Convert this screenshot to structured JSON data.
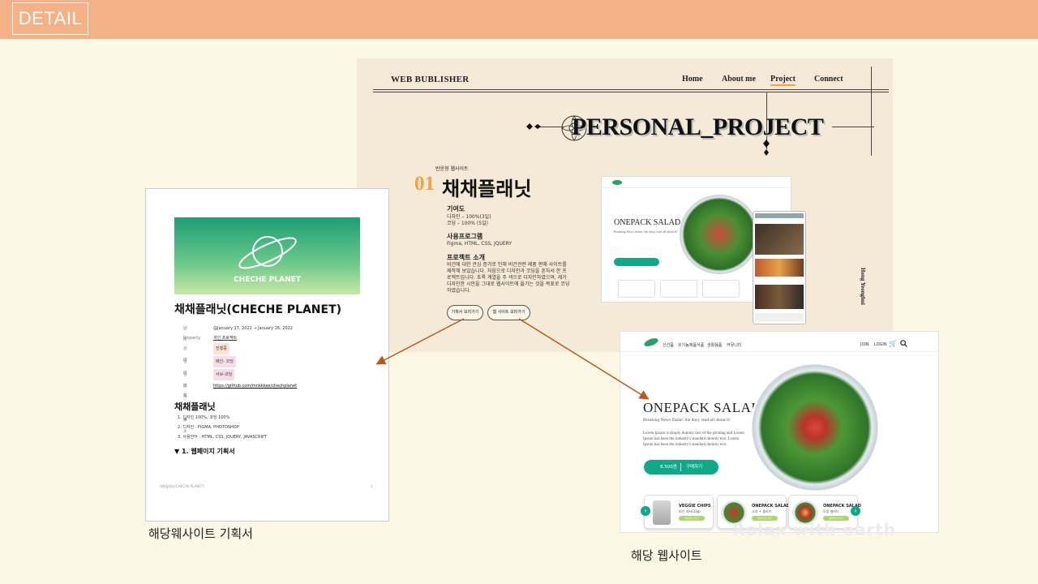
{
  "header": {
    "tag": "DETAIL"
  },
  "hero": {
    "logo": "WEB BUBLISHER",
    "nav": [
      "Home",
      "About me",
      "Project",
      "Connect"
    ],
    "active_nav": "Project",
    "title": "PERSONAL_PROJECT",
    "vertical_name": "Hong Yeonghui",
    "project": {
      "small_label": "반응형 웹사이트",
      "number": "01",
      "name": "채채플래닛",
      "contribution_title": "기여도",
      "contribution_lines": [
        "디자인 – 100%(3일)",
        "코딩 – 100% (5일)"
      ],
      "programs_title": "사용프로그램",
      "programs": "Figma, HTML, CSS, JQUERY",
      "intro_title": "프로젝트 소개",
      "intro_lines": [
        "비건에 대한 관심 증가로 인해 비건관련 제품 판매 사이트를",
        "제작해 보았습니다. 처음으로 디자인과 코딩을 혼자서 한 프",
        "로젝트입니다. 초록 계열을 주 색으로 디자인하였으며, 제가",
        "디자인한 시안을 그대로 웹사이트에 옮기는 것을 목표로 코딩",
        "하였습니다."
      ],
      "button_plan": "기획서 보러가기",
      "button_site": "웹 사이트 보러가기"
    },
    "mockup": {
      "title": "ONEPACK SALAD",
      "subtitle": "Breaking News flashe: the dayy read all about it!"
    }
  },
  "document": {
    "cover_text": "CHECHE PLANET",
    "title": "채채플래닛(CHECHE PLANET)",
    "properties": [
      {
        "key": "날짜",
        "value": "@January 17, 2022 → January 26, 2022",
        "tag_color": ""
      },
      {
        "key": "Property",
        "value": "개인 프로젝트",
        "tag_color": ""
      },
      {
        "key": "상태",
        "value": "진행중",
        "tag_color": "#fde2d6"
      },
      {
        "key": "상태_확인",
        "value": "메인- 코딩",
        "tag_color": "#f7dde8"
      },
      {
        "key": "상태_서브",
        "value": "서브-코딩",
        "tag_color": "#f7dde8"
      },
      {
        "key": "깃 허브 주소",
        "value": "https://github.com/mnkkkee/chechplanet",
        "tag_color": ""
      }
    ],
    "heading": "채채플래닛",
    "list": [
      "디자인 100%, 코딩 100%",
      "디자인 : FIGMA, PHOTOSHOP",
      "사용언어 : HTML, CSS, JQUERY, JAVASCRIPT"
    ],
    "toggle": "▼ 1. 웹페이지 기획서",
    "footer_left": "채채플래닛(CHECHE PLANET)",
    "footer_right": "1"
  },
  "site": {
    "nav": [
      "신선품",
      "유기농제품",
      "식품",
      "생활용품",
      "커뮤니티"
    ],
    "auth": [
      "JOIN",
      "LOGIN"
    ],
    "title": "ONEPACK SALAD",
    "subtitle": "Breaking News flashe: the dayy read all about it!",
    "body": "Lorem Ipsum is simply dummy text of the printing and Lorem Ipsum has been the industry's standard dummy text. Lorem Ipsum has been the industry's standard dummy text.",
    "price_button": "8,500원",
    "buy_label": "구매하기",
    "products": [
      {
        "name": "VEGGIE CHIPS",
        "desc": "비건 과자(33g)",
        "btn": "장바구니 담기"
      },
      {
        "name": "ONEPACK SALAD",
        "desc": "고추 + 올리브",
        "btn": "장바구니 담기"
      },
      {
        "name": "ONEPACK SALAD",
        "desc": "토핑 샐러드",
        "btn": "장바구니 담기"
      }
    ],
    "watermark": "Relax with earth"
  },
  "captions": {
    "document": "해당웨사이트 기획서",
    "site": "해당 웹사이트"
  },
  "colors": {
    "header": "#f3b185",
    "background": "#fdf8e6",
    "accent_orange": "#f3a142",
    "arrow": "#b85a1a",
    "green": "#0fa98a"
  }
}
